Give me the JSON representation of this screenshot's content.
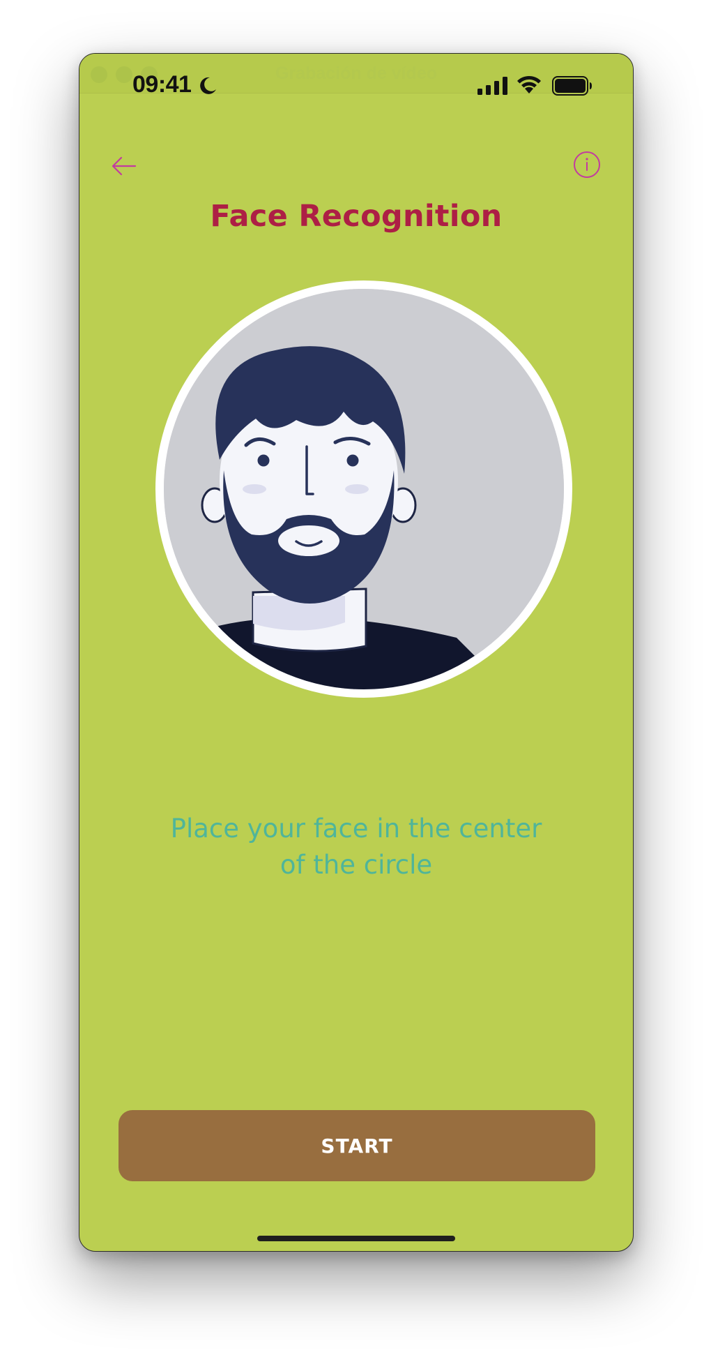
{
  "window": {
    "title": "Grabación de vídeo"
  },
  "status_bar": {
    "time": "09:41",
    "icons": [
      "moon-icon",
      "cellular-signal-icon",
      "wifi-icon",
      "battery-icon"
    ]
  },
  "header": {
    "back_icon": "arrow-left-icon",
    "info_icon": "info-circle-icon",
    "title": "Face Recognition"
  },
  "main": {
    "illustration": "bearded-man-avatar",
    "instruction": "Place your face in the center of the circle"
  },
  "footer": {
    "start_label": "START"
  },
  "colors": {
    "background": "#BBCF51",
    "title": "#AD1F45",
    "accent_icons": "#C23BA0",
    "instruction_text": "#4FB59A",
    "button": "#986E3F",
    "button_text": "#FFFFFF",
    "circle_border": "#FFFFFF",
    "avatar_dark": "#27325A"
  }
}
